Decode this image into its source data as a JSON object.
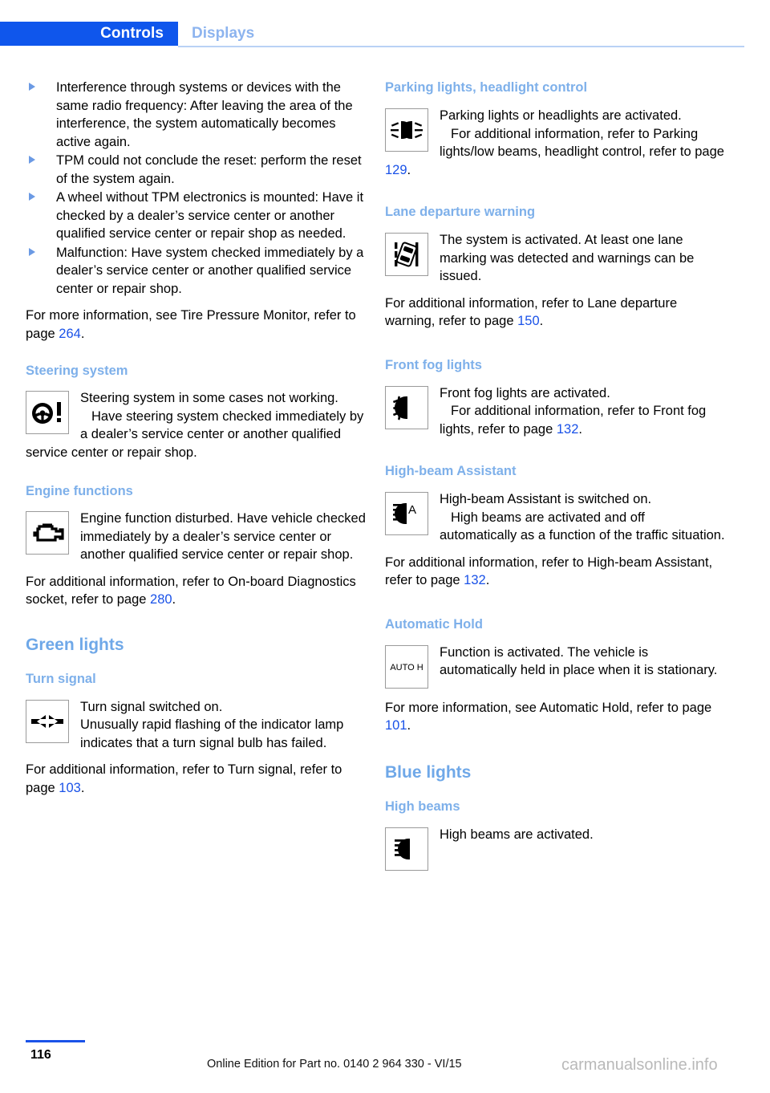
{
  "header": {
    "active_tab": "Controls",
    "inactive_tab": "Displays",
    "active_tab_color": "#0f56ec",
    "inactive_tab_color": "#8db4ef"
  },
  "left_column": {
    "bullets": [
      "Interference through systems or devices with the same radio frequency: After leaving the area of the interference, the system automatically becomes active again.",
      "TPM could not conclude the reset: perform the reset of the system again.",
      "A wheel without TPM electronics is mounted: Have it checked by a dealer’s service center or another qualified service center or repair shop as needed.",
      "Malfunction: Have system checked immediately by a dealer’s service center or another qualified service center or repair shop."
    ],
    "tpm_reference": {
      "text_before": "For more information, see Tire Pressure Monitor, refer to page ",
      "page": "264",
      "text_after": "."
    },
    "steering": {
      "heading": "Steering system",
      "icon": "steering-wheel-warning-icon",
      "lead": "Steering system in some cases not working.",
      "body": "Have steering system checked immediately by a dealer’s service center or another qualified service center or repair shop."
    },
    "engine": {
      "heading": "Engine functions",
      "icon": "check-engine-icon",
      "lead": "Engine function disturbed. Have vehicle checked immediately by a dealer’s service center or another qualified service center or repair shop.",
      "reference": {
        "text_before": "For additional information, refer to On-board Diagnostics socket, refer to page ",
        "page": "280",
        "text_after": "."
      }
    },
    "green_lights": {
      "heading": "Green lights",
      "turn_signal": {
        "heading": "Turn signal",
        "icon": "turn-signal-arrows-icon",
        "lead": "Turn signal switched on.",
        "body": "Unusually rapid flashing of the indicator lamp indicates that a turn signal bulb has failed.",
        "reference": {
          "text_before": "For additional information, refer to Turn signal, refer to page ",
          "page": "103",
          "text_after": "."
        }
      }
    }
  },
  "right_column": {
    "parking_lights": {
      "heading": "Parking lights, headlight control",
      "icon": "parking-lights-icon",
      "lead": "Parking lights or headlights are activated.",
      "reference": {
        "text_before": "For additional information, refer to Parking lights/low beams, headlight control, refer to page ",
        "page": "129",
        "text_after": "."
      }
    },
    "lane_departure": {
      "heading": "Lane departure warning",
      "icon": "lane-departure-warning-icon",
      "lead": "The system is activated. At least one lane marking was detected and warnings can be issued.",
      "reference": {
        "text_before": "For additional information, refer to Lane departure warning, refer to page ",
        "page": "150",
        "text_after": "."
      }
    },
    "front_fog": {
      "heading": "Front fog lights",
      "icon": "front-fog-light-icon",
      "lead": "Front fog lights are activated.",
      "reference": {
        "text_before": "For additional information, refer to Front fog lights, refer to page ",
        "page": "132",
        "text_after": "."
      }
    },
    "high_beam_assistant": {
      "heading": "High-beam Assistant",
      "icon": "high-beam-assistant-icon",
      "lead": "High-beam Assistant is switched on.",
      "body": "High beams are activated and off automatically as a function of the traffic situation.",
      "reference": {
        "text_before": "For additional information, refer to High-beam Assistant, refer to page ",
        "page": "132",
        "text_after": "."
      }
    },
    "automatic_hold": {
      "heading": "Automatic Hold",
      "icon": "auto-hold-icon",
      "icon_label": "AUTO H",
      "lead": "Function is activated. The vehicle is automatically held in place when it is stationary.",
      "reference": {
        "text_before": "For more information, see Automatic Hold, refer to page ",
        "page": "101",
        "text_after": "."
      }
    },
    "blue_lights": {
      "heading": "Blue lights",
      "high_beams": {
        "heading": "High beams",
        "icon": "high-beams-icon",
        "lead": "High beams are activated."
      }
    }
  },
  "footer": {
    "page_number": "116",
    "edition": "Online Edition for Part no. 0140 2 964 330 - VI/15",
    "watermark": "carmanualsonline.info"
  }
}
